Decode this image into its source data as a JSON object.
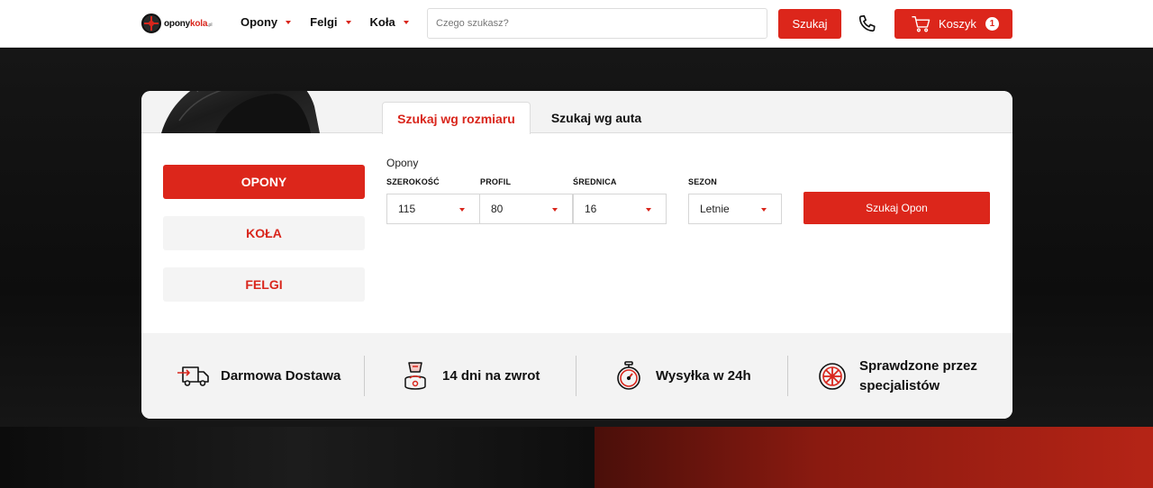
{
  "header": {
    "logo": {
      "part1": "opony",
      "part2": "kola",
      "suffix": ".pl"
    },
    "nav": [
      {
        "label": "Opony"
      },
      {
        "label": "Felgi"
      },
      {
        "label": "Koła"
      }
    ],
    "search": {
      "placeholder": "Czego szukasz?",
      "button_label": "Szukaj"
    },
    "cart": {
      "label": "Koszyk",
      "count": "1"
    }
  },
  "search_panel": {
    "tabs": [
      {
        "label": "Szukaj wg rozmiaru",
        "active": true
      },
      {
        "label": "Szukaj wg auta",
        "active": false
      }
    ],
    "categories": [
      {
        "label": "OPONY",
        "active": true
      },
      {
        "label": "KOŁA",
        "active": false
      },
      {
        "label": "FELGI",
        "active": false
      }
    ],
    "section_label": "Opony",
    "fields": [
      {
        "label": "SZEROKOŚĆ",
        "value": "115"
      },
      {
        "label": "PROFIL",
        "value": "80"
      },
      {
        "label": "ŚREDNICA",
        "value": "16"
      },
      {
        "label": "SEZON",
        "value": "Letnie"
      }
    ],
    "submit_label": "Szukaj Opon"
  },
  "features": [
    {
      "text": "Darmowa Dostawa",
      "icon": "delivery-truck-icon"
    },
    {
      "text": "14 dni na zwrot",
      "icon": "return-box-icon"
    },
    {
      "text": "Wysyłka w 24h",
      "icon": "stopwatch-icon"
    },
    {
      "text": "Sprawdzone przez specjalistów",
      "icon": "wheel-check-icon"
    }
  ],
  "colors": {
    "accent": "#dc261b",
    "panel": "#f3f3f3",
    "background": "#111111"
  }
}
